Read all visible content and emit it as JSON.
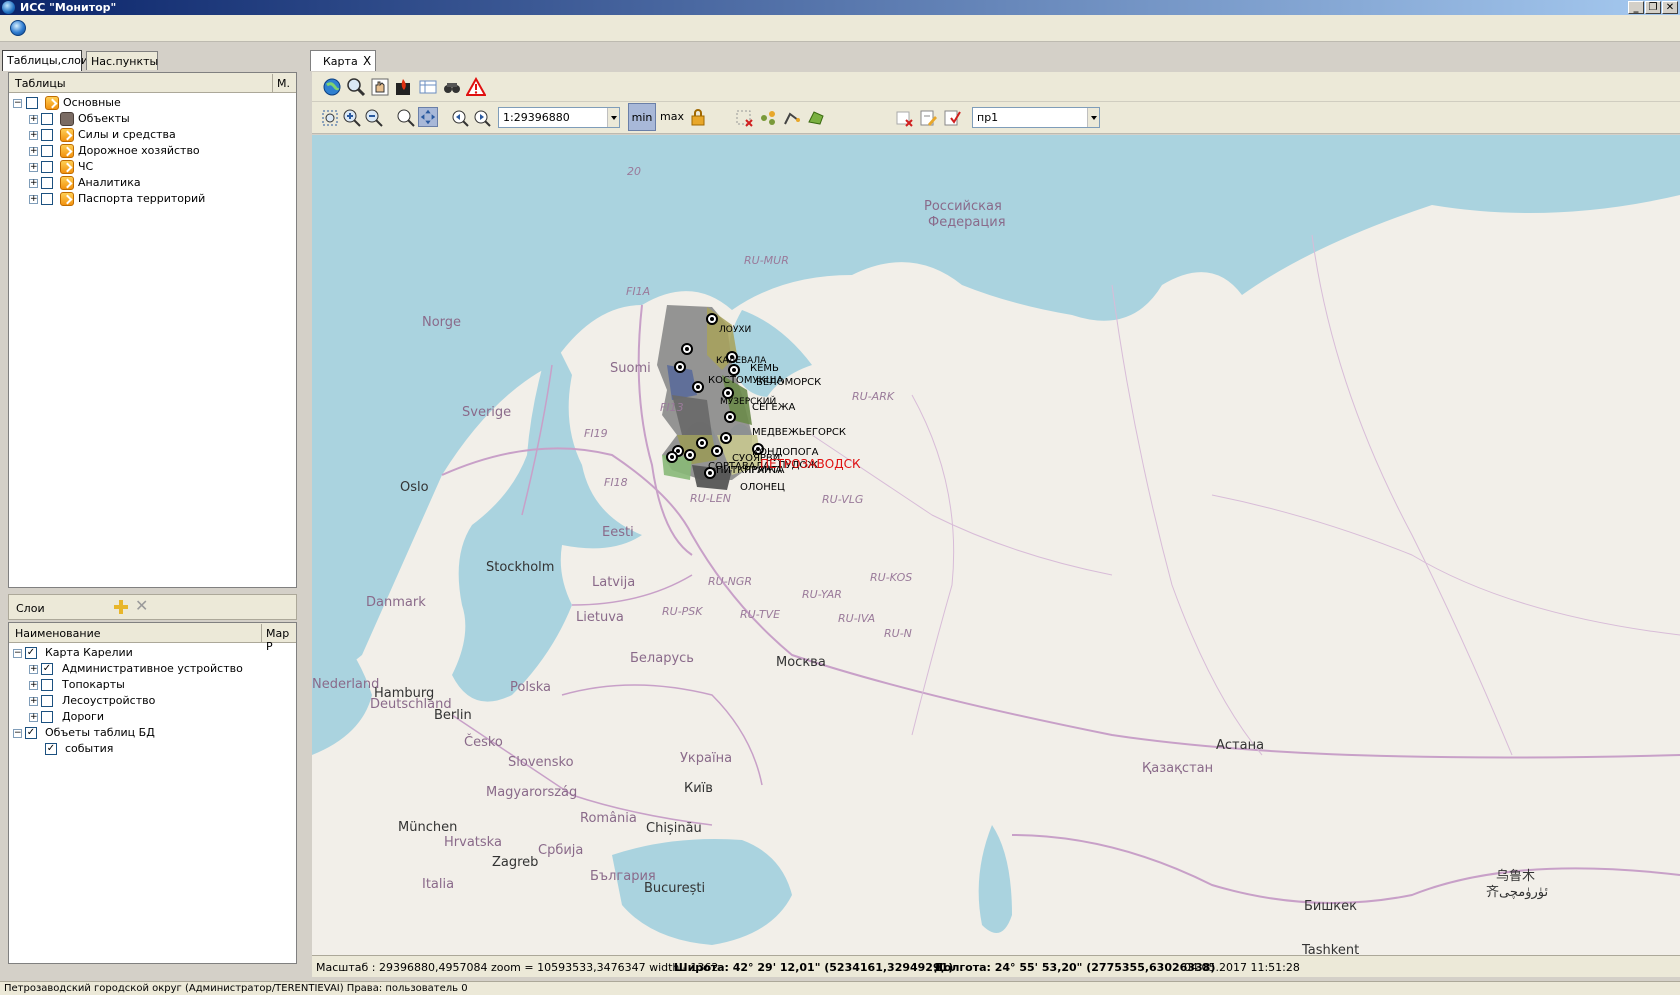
{
  "window": {
    "title": "ИСС \"Монитор\"",
    "minimize": "_",
    "restore": "❐",
    "close": "✕"
  },
  "left_tabs": [
    "Таблицы,слои",
    "Нас.пункты"
  ],
  "tables_panel": {
    "header": "Таблицы",
    "header_btn": "М.",
    "root": "Основные",
    "items": [
      "Объекты",
      "Силы и средства",
      "Дорожное хозяйство",
      "ЧС",
      "Аналитика",
      "Паспорта территорий"
    ]
  },
  "layers_bar": {
    "label": "Слои",
    "add": "+",
    "remove": "✕"
  },
  "layers_panel": {
    "col_name": "Наименование",
    "col_map": "Map P",
    "root1": "Карта Карелии",
    "root1_items": [
      "Административное устройство",
      "Топокарты",
      "Лесоустройство",
      "Дороги"
    ],
    "root2": "Объеты таблиц БД",
    "root2_items": [
      "события"
    ],
    "check_mark": "✓"
  },
  "map_tab": {
    "label": "Карта",
    "close": "X"
  },
  "toolbar": {
    "scale_value": "1:29396880",
    "min_label": "min",
    "max_label": "max",
    "layer_select": "пр1"
  },
  "map_labels": {
    "countries": [
      "Российская",
      "Федерация",
      "Norge",
      "Suomi",
      "Sverige",
      "Eesti",
      "Latvija",
      "Lietuva",
      "Danmark",
      "Беларусь",
      "Polska",
      "Deutschland",
      "Nederland",
      "Česko",
      "Slovensko",
      "Magyarország",
      "România",
      "Україна",
      "Hrvatska",
      "Србија",
      "Italia",
      "България",
      "Қазақстан"
    ],
    "cities": [
      "Oslo",
      "Stockholm",
      "Hamburg",
      "Berlin",
      "Москва",
      "Київ",
      "München",
      "Chișinău",
      "Zagreb",
      "București",
      "Астана",
      "Бишкек",
      "Tashkent",
      "乌鲁木",
      "齐ئۈرۈمچی"
    ],
    "regions": [
      "RU-MUR",
      "FI1A",
      "FI13",
      "FI19",
      "FI18",
      "RU-ARK",
      "RU-LEN",
      "RU-VLG",
      "RU-NGR",
      "RU-YAR",
      "RU-KOS",
      "RU-PSK",
      "RU-TVE",
      "RU-IVA",
      "RU-N"
    ],
    "graticule": "20",
    "karelia_points": [
      "ЛОУХИ",
      "КАЛЕВАЛА",
      "КЕМЬ",
      "КОСТОМУКША",
      "БЕЛОМОРСК",
      "МУЗЕРСКИЙ",
      "СЕГЕЖА",
      "МЕДВЕЖЬЕГОРСК",
      "КОНДОПОГА",
      "СУОЯРВИ",
      "СОРТАВАЛА",
      "ПИТКЯРАНТА",
      "ПРЯЖА",
      "ОЛОНЕЦ",
      "ПУДОЖ"
    ],
    "capital": "ПЕТРОЗАВОДСК"
  },
  "status": {
    "scale_info": "Масштаб : 29396880,4957084 zoom = 10593533,3476347 width - 1362",
    "lat": "Широта:  42° 29' 12,01\" (5234161,32949291)",
    "lon": "Долгота: 24° 55' 53,20\" (2775355,63026338)",
    "datetime": "04.05.2017 11:51:28"
  },
  "bottom": {
    "text": "Петрозаводский городской округ (Администратор/TERENTIEVAI)  Права: пользователь    0"
  },
  "colors": {
    "sea": "#aad3df",
    "land": "#f2efe9",
    "border": "#c8a0c8",
    "capital": "#e01010"
  }
}
